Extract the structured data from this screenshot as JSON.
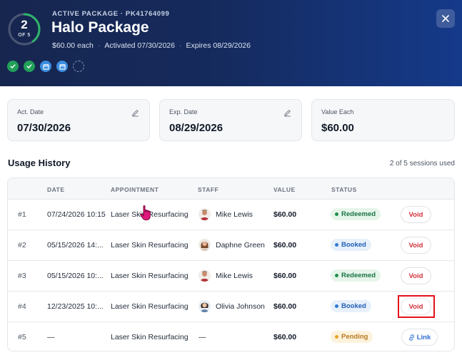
{
  "header": {
    "eyebrow": "ACTIVE PACKAGE · PK41764099",
    "title": "Halo Package",
    "price": "$60.00 each",
    "activated": "Activated 07/30/2026",
    "expires": "Expires 08/29/2026",
    "ring": {
      "used": "2",
      "of": "OF 5",
      "fraction": 0.4
    },
    "close_icon": "close-icon",
    "pips": [
      {
        "state": "done",
        "icon": "check-icon"
      },
      {
        "state": "done",
        "icon": "check-icon"
      },
      {
        "state": "booked",
        "icon": "calendar-icon"
      },
      {
        "state": "booked",
        "icon": "calendar-icon"
      },
      {
        "state": "empty",
        "icon": ""
      }
    ]
  },
  "cards": [
    {
      "label": "Act. Date",
      "value": "07/30/2026",
      "editable": true
    },
    {
      "label": "Exp. Date",
      "value": "08/29/2026",
      "editable": true
    },
    {
      "label": "Value Each",
      "value": "$60.00",
      "editable": false
    }
  ],
  "usage": {
    "title": "Usage History",
    "meta": "2 of 5 sessions used",
    "columns": [
      "DATE",
      "APPOINTMENT",
      "STAFF",
      "VALUE",
      "STATUS"
    ],
    "rows": [
      {
        "num": "#1",
        "date": "07/24/2026 10:15",
        "appointment": "Laser Skin Resurfacing",
        "staff": "Mike Lewis",
        "avatar": "mike",
        "value": "$60.00",
        "status": "Redeemed",
        "status_kind": "redeemed",
        "action": "Void"
      },
      {
        "num": "#2",
        "date": "05/15/2026 14:...",
        "appointment": "Laser Skin Resurfacing",
        "staff": "Daphne Green",
        "avatar": "daphne",
        "value": "$60.00",
        "status": "Booked",
        "status_kind": "booked",
        "action": "Void"
      },
      {
        "num": "#3",
        "date": "05/15/2026 10:...",
        "appointment": "Laser Skin Resurfacing",
        "staff": "Mike Lewis",
        "avatar": "mike",
        "value": "$60.00",
        "status": "Redeemed",
        "status_kind": "redeemed",
        "action": "Void"
      },
      {
        "num": "#4",
        "date": "12/23/2025 10:...",
        "appointment": "Laser Skin Resurfacing",
        "staff": "Olivia Johnson",
        "avatar": "olivia",
        "value": "$60.00",
        "status": "Booked",
        "status_kind": "booked",
        "action": "Void"
      },
      {
        "num": "#5",
        "date": "—",
        "appointment": "Laser Skin Resurfacing",
        "staff": "—",
        "avatar": "",
        "value": "$60.00",
        "status": "Pending",
        "status_kind": "pending",
        "action": "Link"
      }
    ]
  },
  "colors": {
    "header_bg": "#17264f",
    "accent_green": "#22a05a",
    "accent_blue": "#3b8de0",
    "void_red": "#d2323a",
    "highlight_red": "#e3121c"
  }
}
